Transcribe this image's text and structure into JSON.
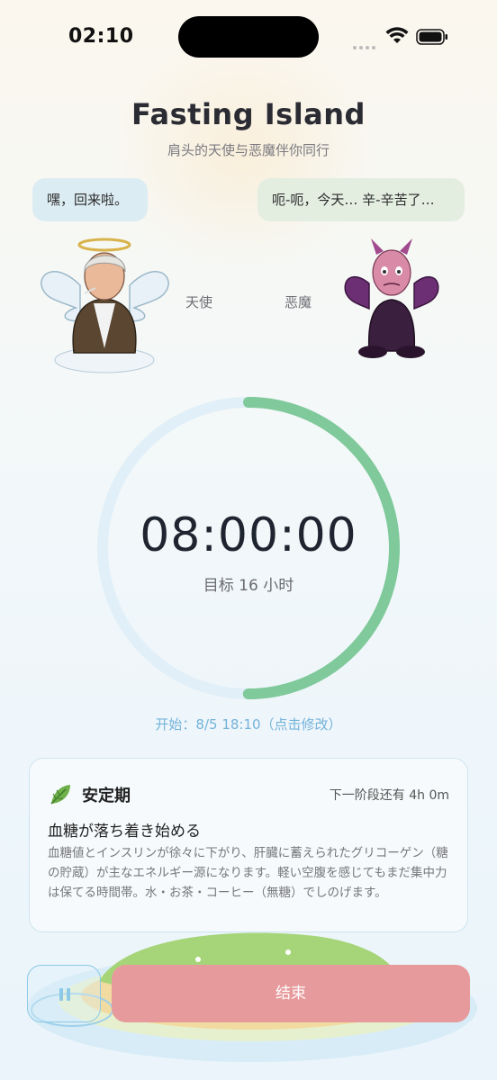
{
  "status_bar": {
    "time": "02:10"
  },
  "header": {
    "title": "Fasting Island",
    "subtitle": "肩头的天使与恶魔伴你同行"
  },
  "companions": {
    "angel": {
      "speech": "嘿，回来啦。",
      "label": "天使"
    },
    "devil": {
      "speech": "呃-呃，今天… 辛-辛苦了…",
      "label": "恶魔"
    }
  },
  "timer": {
    "elapsed": "08:00:00",
    "goal": "目标 16 小时",
    "progress": 0.5,
    "start": "开始：8/5 18:10（点击修改）"
  },
  "phase_card": {
    "icon": "leaf-icon",
    "name": "安定期",
    "next_phase": "下一阶段还有 4h 0m",
    "headline": "血糖が落ち着き始める",
    "description": "血糖値とインスリンが徐々に下がり、肝臓に蓄えられたグリコーゲン（糖の貯蔵）が主なエネルギー源になります。軽い空腹を感じてもまだ集中力は保てる時間帯。水・お茶・コーヒー（無糖）でしのげます。"
  },
  "actions": {
    "pause_icon": "pause-icon",
    "end_label": "结束"
  },
  "colors": {
    "ring_progress": "#7fc99a",
    "ring_track": "#e1eff8",
    "end_button": "#e79a9b",
    "accent_blue": "#74b3da"
  }
}
